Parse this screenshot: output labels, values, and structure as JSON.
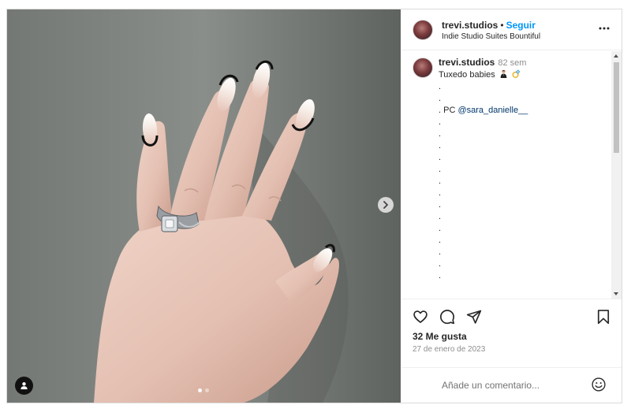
{
  "post": {
    "username": "trevi.studios",
    "separator": "•",
    "follow_label": "Seguir",
    "location": "Indie Studio Suites Bountiful",
    "more_icon": "more-options-icon"
  },
  "caption": {
    "username": "trevi.studios",
    "time": "82 sem",
    "text": "Tuxedo babies",
    "emojis": [
      "man-in-tuxedo-emoji",
      "ring-emoji"
    ],
    "dot_line": ".",
    "credit_prefix": ". PC ",
    "mention": "@sara_danielle__"
  },
  "media": {
    "carousel_count": 2,
    "active_index": 0,
    "next_icon": "chevron-right-icon",
    "tag_icon": "user-tag-icon"
  },
  "actions": {
    "icons": [
      "heart-icon",
      "comment-icon",
      "share-icon",
      "bookmark-icon"
    ],
    "likes": "32 Me gusta",
    "date": "27 de enero de 2023"
  },
  "comment_box": {
    "placeholder": "Añade un comentario...",
    "emoji_icon": "smiley-icon"
  },
  "colors": {
    "accent": "#0095f6",
    "text": "#262626",
    "secondary": "#8e8e8e",
    "mention": "#00376b"
  }
}
